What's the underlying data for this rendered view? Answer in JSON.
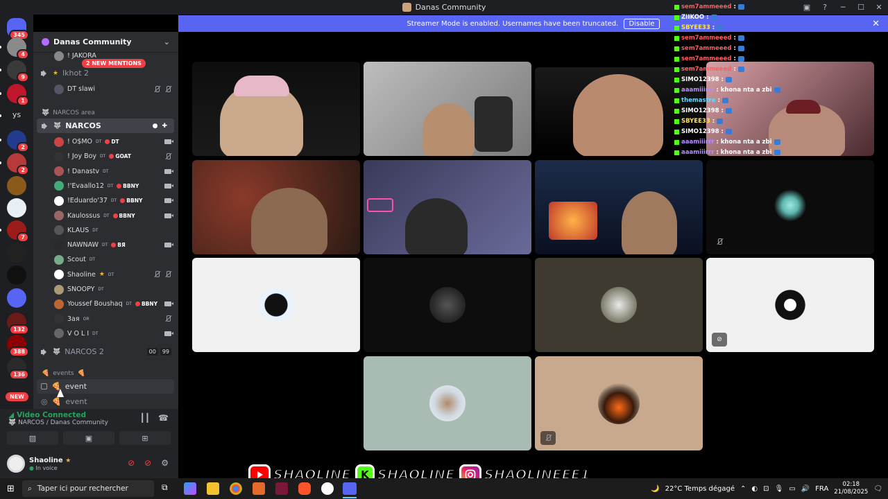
{
  "window": {
    "title": "Danas Community",
    "controls": [
      "─",
      "☐",
      "✕"
    ]
  },
  "banner": {
    "text": "Streamer Mode is enabled. Usernames have been truncated.",
    "disable_label": "Disable",
    "close": "✕"
  },
  "rail": {
    "servers": [
      {
        "badge": "345",
        "color": "#5865f2"
      },
      {
        "badge": "4",
        "color": "#8a8a8a"
      },
      {
        "badge": "9",
        "color": "#3a3a3a"
      },
      {
        "badge": "1",
        "color": "#c0162b"
      },
      {
        "badge": "",
        "label": "ys",
        "color": "#1e1f22"
      },
      {
        "badge": "2",
        "color": "#243a8c"
      },
      {
        "badge": "2",
        "color": "#b73a3a"
      },
      {
        "badge": "",
        "color": "#8a5a1a"
      },
      {
        "badge": "",
        "color": "#e8f0f5"
      },
      {
        "badge": "7",
        "color": "#9c1c1c"
      },
      {
        "badge": "",
        "color": "#222"
      },
      {
        "badge": "",
        "color": "#111"
      },
      {
        "badge": "",
        "color": "#5865f2"
      },
      {
        "badge": "132",
        "color": "#6b1a1a"
      },
      {
        "badge": "388",
        "color": "#8b0000"
      },
      {
        "badge": "136",
        "color": "#2a2a2a"
      }
    ],
    "new_label": "NEW"
  },
  "sidebar": {
    "server_name": "Danas Community",
    "mentions_label": "2 NEW MENTIONS",
    "top_user": "! JAKORA",
    "channel_lkhot": "lkhot 2",
    "lkhot_user": "DT slawi",
    "category_narcos": "NARCOS area",
    "active_channel": "NARCOS",
    "members": [
      {
        "name": "! O$MO",
        "tag": "DT",
        "role": "DT",
        "color": "#c44",
        "icon": "cam"
      },
      {
        "name": "! Joy Boy",
        "tag": "DT",
        "role": "GOAT",
        "color": "#333",
        "icon": "mute"
      },
      {
        "name": "! Danastv",
        "tag": "DT",
        "role": "",
        "color": "#a55",
        "icon": "cam"
      },
      {
        "name": "!'Evaallo12",
        "tag": "DT",
        "role": "BBNY",
        "color": "#4a7",
        "icon": "cam"
      },
      {
        "name": "!Eduardo'37",
        "tag": "DT",
        "role": "BBNY",
        "color": "#fff",
        "icon": "cam"
      },
      {
        "name": "Kaulossus",
        "tag": "DT",
        "role": "BBNY",
        "color": "#966",
        "icon": "cam"
      },
      {
        "name": "KLAUS",
        "tag": "DT",
        "role": "",
        "color": "#555",
        "icon": ""
      },
      {
        "name": "NAWNAW",
        "tag": "DT",
        "role": "BЯ",
        "color": "#2a2a2a",
        "icon": "cam"
      },
      {
        "name": "Scout",
        "tag": "DT",
        "role": "",
        "color": "#7a8",
        "icon": ""
      },
      {
        "name": "Shaoline",
        "tag": "DT",
        "role": "",
        "color": "#fff",
        "icon": "mute2"
      },
      {
        "name": "SNOOPY",
        "tag": "DT",
        "role": "",
        "color": "#a97",
        "icon": ""
      },
      {
        "name": "Youssef Boushaq",
        "tag": "DT",
        "role": "BBNY",
        "color": "#b63",
        "icon": "cam"
      },
      {
        "name": "3ая",
        "tag": "OR",
        "role": "",
        "color": "#333",
        "icon": "mute"
      },
      {
        "name": "V O L I",
        "tag": "DT",
        "role": "",
        "color": "#666",
        "icon": "cam"
      }
    ],
    "channel_narcos2": "NARCOS 2",
    "narcos2_counts": [
      "00",
      "99"
    ],
    "category_events": "events",
    "event_channel_1": "event",
    "event_channel_2": "event"
  },
  "voice_panel": {
    "status": "Video Connected",
    "channel": "NARCOS / Danas Community"
  },
  "user_panel": {
    "name": "Shaoline",
    "status": "In voice"
  },
  "chat": [
    {
      "user": "sem7ammeeed",
      "msg": ":",
      "color": "#ff5c5c"
    },
    {
      "user": "ZIIKOO",
      "msg": ":",
      "color": "#fff"
    },
    {
      "user": "SBYEE33",
      "msg": ":",
      "color": "#ffe14d"
    },
    {
      "user": "sem7ammeeed",
      "msg": ":",
      "color": "#ff5c5c"
    },
    {
      "user": "sem7ammeeed",
      "msg": ":",
      "color": "#ff5c5c"
    },
    {
      "user": "sem7ammeeed",
      "msg": ":",
      "color": "#ff5c5c"
    },
    {
      "user": "sem7ammeeed",
      "msg": ":",
      "color": "#ff5c5c"
    },
    {
      "user": "SIMO12398",
      "msg": ":",
      "color": "#fff"
    },
    {
      "user": "aaamiiirrr",
      "msg": ": khona nta a zbi",
      "color": "#b690ff"
    },
    {
      "user": "themastre",
      "msg": ":",
      "color": "#66d9ff"
    },
    {
      "user": "SIMO12398",
      "msg": ":",
      "color": "#fff"
    },
    {
      "user": "SBYEE33",
      "msg": ":",
      "color": "#ffe14d"
    },
    {
      "user": "SIMO12398",
      "msg": ":",
      "color": "#fff"
    },
    {
      "user": "aaamiiirrr",
      "msg": ": khona nta a zbi",
      "color": "#b690ff"
    },
    {
      "user": "aaamiiirrr",
      "msg": ": khona nta a zbi",
      "color": "#b690ff"
    }
  ],
  "social": {
    "youtube": "SHAOLINE",
    "kick": "SHAOLINE",
    "instagram": "SHAOLINEEE1"
  },
  "taskbar": {
    "search_placeholder": "Taper ici pour rechercher",
    "weather": "22°C  Temps dégagé",
    "lang": "FRA",
    "time": "02:18",
    "date": "21/08/2025"
  }
}
